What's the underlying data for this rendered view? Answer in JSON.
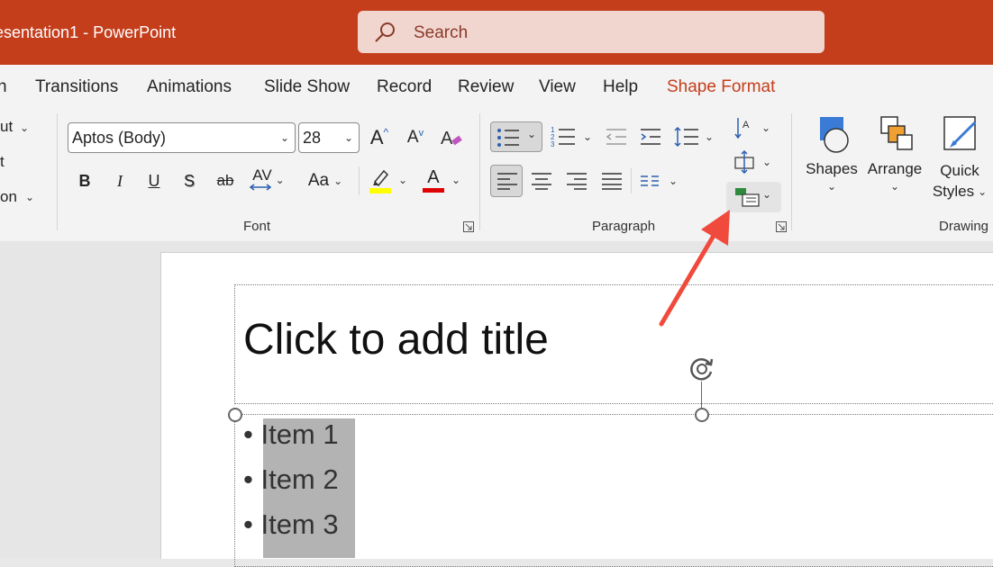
{
  "titlebar": {
    "doc_title": "esentation1  -  PowerPoint",
    "search_placeholder": "Search",
    "bg_color": "#c43e1c"
  },
  "tabs": [
    {
      "label": "n"
    },
    {
      "label": "Transitions"
    },
    {
      "label": "Animations"
    },
    {
      "label": "Slide Show"
    },
    {
      "label": "Record"
    },
    {
      "label": "Review"
    },
    {
      "label": "View"
    },
    {
      "label": "Help"
    },
    {
      "label": "Shape Format",
      "active": true
    }
  ],
  "ribbon": {
    "slides_group": {
      "layout_label": "ut",
      "reset_label": "t",
      "section_label": "on"
    },
    "font_group": {
      "label": "Font",
      "font_name": "Aptos (Body)",
      "font_size": "28",
      "grow_label": "A",
      "shrink_label": "A",
      "bold_label": "B",
      "italic_label": "I",
      "underline_label": "U",
      "shadow_label": "S",
      "strike_label": "ab",
      "spacing_label": "AV",
      "case_label": "Aa",
      "font_color_label": "A",
      "highlight_color": "#ffff00",
      "font_color": "#e00000"
    },
    "paragraph_group": {
      "label": "Paragraph"
    },
    "drawing_group": {
      "label": "Drawing",
      "shapes_label": "Shapes",
      "arrange_label": "Arrange",
      "quick_styles_line1": "Quick",
      "quick_styles_line2": "Styles"
    }
  },
  "slide": {
    "title_placeholder": "Click to add title",
    "bullets": [
      "Item 1",
      "Item 2",
      "Item 3"
    ]
  },
  "annotation": {
    "arrow_color": "#f04a3c",
    "icons": [
      "search-icon",
      "bullets-icon",
      "numbering-icon",
      "decrease-indent-icon",
      "increase-indent-icon",
      "line-spacing-icon",
      "text-direction-icon",
      "align-text-icon",
      "convert-to-smartart-icon",
      "rotate-handle-icon"
    ]
  }
}
